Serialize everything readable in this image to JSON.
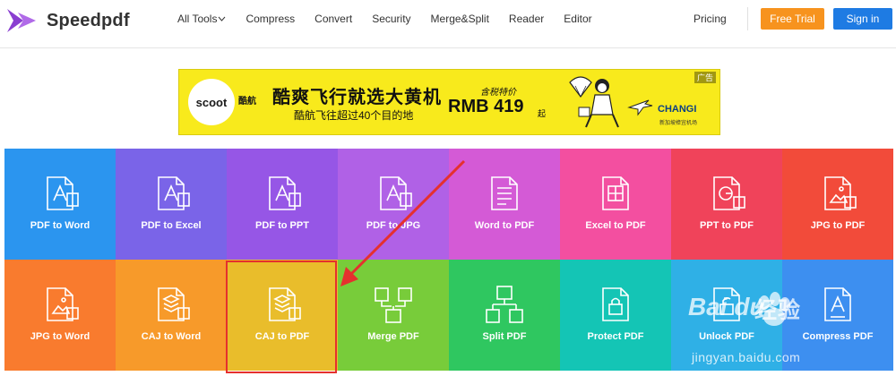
{
  "header": {
    "brand": "Speedpdf",
    "nav": [
      {
        "label": "All Tools",
        "has_dropdown": true
      },
      {
        "label": "Compress"
      },
      {
        "label": "Convert"
      },
      {
        "label": "Security"
      },
      {
        "label": "Merge&Split"
      },
      {
        "label": "Reader"
      },
      {
        "label": "Editor"
      }
    ],
    "pricing": "Pricing",
    "free_trial": "Free Trial",
    "sign_in": "Sign in"
  },
  "ad": {
    "brand": "scoot",
    "brand_cn": "酷航",
    "title": "酷爽飞行就选大黄机",
    "subtitle": "酷航飞往超过40个目的地",
    "price_label": "含税特价",
    "price": "RMB 419",
    "price_suffix": "起",
    "tag": "广告",
    "partner": "CHANGI",
    "partner_sub": "新加坡樟宜机场"
  },
  "tools": [
    {
      "label": "PDF to Word",
      "color": "#2b95ef",
      "icon": "pdf-to-word-icon"
    },
    {
      "label": "PDF to Excel",
      "color": "#7a64e8",
      "icon": "pdf-to-excel-icon"
    },
    {
      "label": "PDF to PPT",
      "color": "#9656e6",
      "icon": "pdf-to-ppt-icon"
    },
    {
      "label": "PDF to JPG",
      "color": "#b061e6",
      "icon": "pdf-to-jpg-icon"
    },
    {
      "label": "Word to PDF",
      "color": "#d45ad6",
      "icon": "word-to-pdf-icon"
    },
    {
      "label": "Excel to PDF",
      "color": "#f34fa0",
      "icon": "excel-to-pdf-icon"
    },
    {
      "label": "PPT to PDF",
      "color": "#f0435a",
      "icon": "ppt-to-pdf-icon"
    },
    {
      "label": "JPG to PDF",
      "color": "#f24b3a",
      "icon": "jpg-to-pdf-icon"
    },
    {
      "label": "JPG to Word",
      "color": "#f97b2e",
      "icon": "jpg-to-word-icon"
    },
    {
      "label": "CAJ to Word",
      "color": "#f79a2a",
      "icon": "caj-to-word-icon"
    },
    {
      "label": "CAJ to PDF",
      "color": "#e9bd2b",
      "icon": "caj-to-pdf-icon"
    },
    {
      "label": "Merge PDF",
      "color": "#78cc3a",
      "icon": "merge-pdf-icon"
    },
    {
      "label": "Split PDF",
      "color": "#2fc760",
      "icon": "split-pdf-icon"
    },
    {
      "label": "Protect PDF",
      "color": "#14c5b5",
      "icon": "protect-pdf-icon"
    },
    {
      "label": "Unlock PDF",
      "color": "#2fb0e6",
      "icon": "unlock-pdf-icon"
    },
    {
      "label": "Compress PDF",
      "color": "#3d8ff0",
      "icon": "compress-pdf-icon"
    }
  ],
  "watermark": {
    "brand": "Bai du",
    "text": "经验",
    "url": "jingyan.baidu.com"
  }
}
